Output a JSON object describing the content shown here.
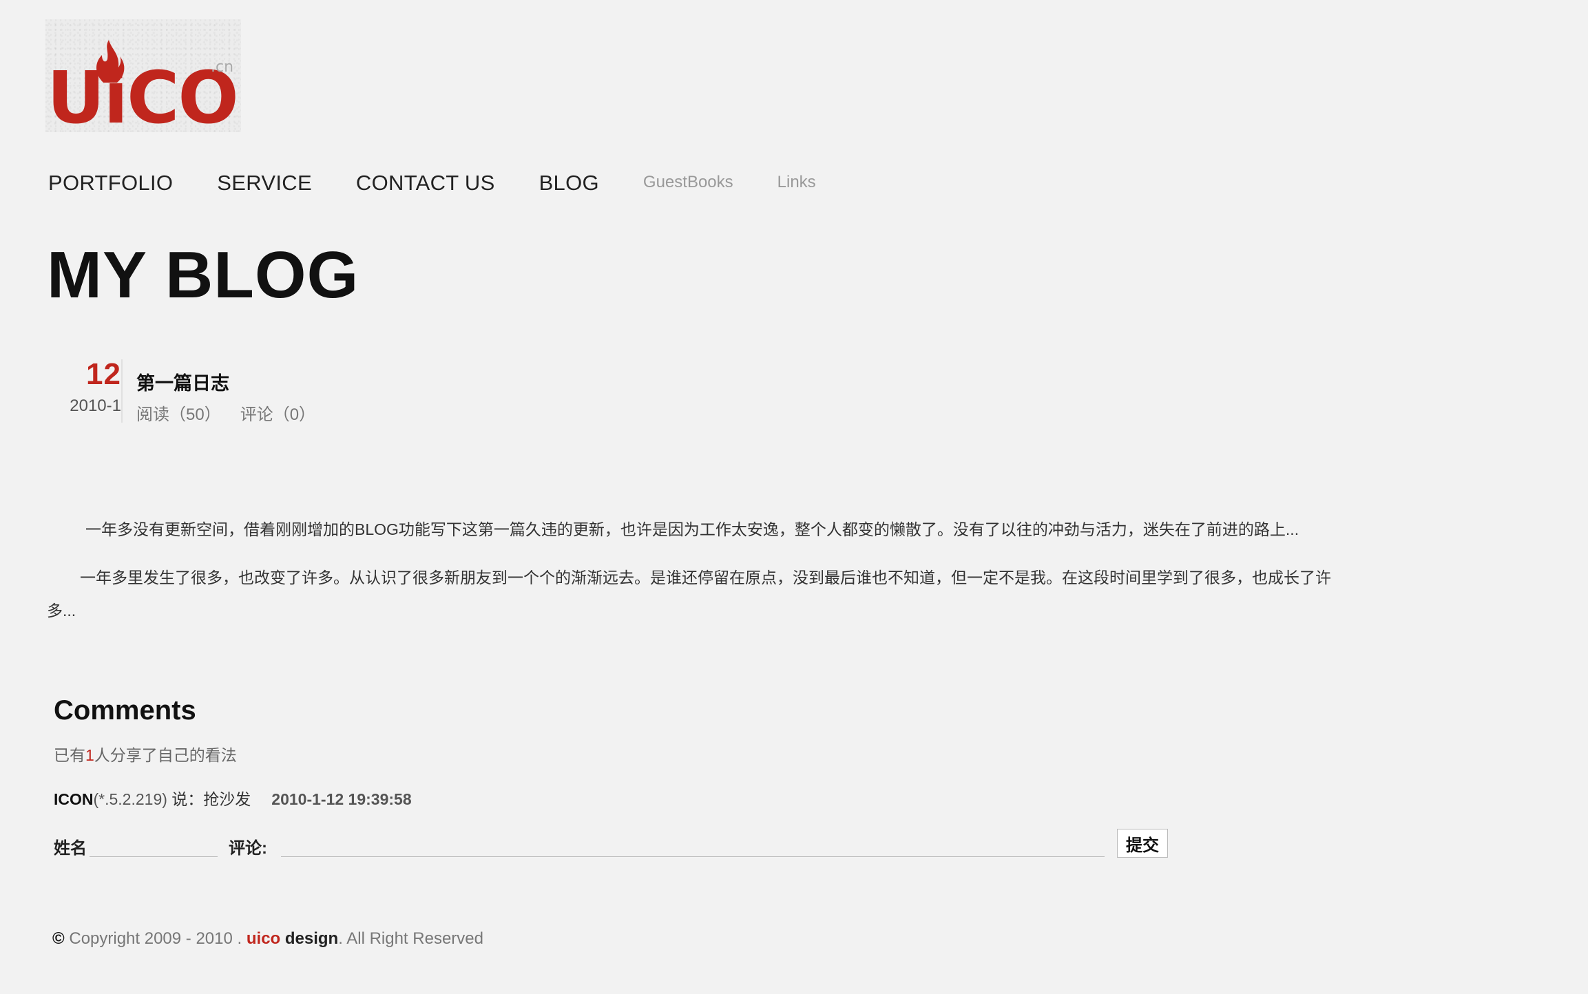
{
  "logo": {
    "text": "UiCO",
    "suffix": ".cn",
    "accent_color": "#c0261d"
  },
  "nav": {
    "main_items": [
      {
        "label": "PORTFOLIO"
      },
      {
        "label": "SERVICE"
      },
      {
        "label": "CONTACT US"
      },
      {
        "label": "BLOG"
      }
    ],
    "sub_items": [
      {
        "label": "GuestBooks"
      },
      {
        "label": "Links"
      }
    ]
  },
  "page_title": "MY BLOG",
  "post": {
    "day": "12",
    "month": "2010-1",
    "title": "第一篇日志",
    "reads": "阅读（50）",
    "comments": "评论（0）",
    "paragraphs": [
      "一年多没有更新空间，借着刚刚增加的BLOG功能写下这第一篇久违的更新，也许是因为工作太安逸，整个人都变的懒散了。没有了以往的冲劲与活力，迷失在了前进的路上...",
      "一年多里发生了很多，也改变了许多。从认识了很多新朋友到一个个的渐渐远去。是谁还停留在原点，没到最后谁也不知道，但一定不是我。在这段时间里学到了很多，也成长了许多..."
    ]
  },
  "comments": {
    "heading": "Comments",
    "count_prefix": "已有",
    "count": "1",
    "count_suffix": "人分享了自己的看法",
    "items": [
      {
        "author": "ICON",
        "ip": "(*.5.2.219)",
        "says": " 说：",
        "text": "抢沙发",
        "time": "2010-1-12 19:39:58"
      }
    ],
    "form": {
      "name_label": "姓名",
      "name_value": "",
      "comment_label": "评论:",
      "comment_value": "",
      "submit_label": "提交"
    }
  },
  "footer": {
    "copy_symbol": "©",
    "copyright": " Copyright 2009 - 2010 . ",
    "brand_red": "uico",
    "brand_dark": " design",
    "rights": ". All Right Reserved"
  }
}
